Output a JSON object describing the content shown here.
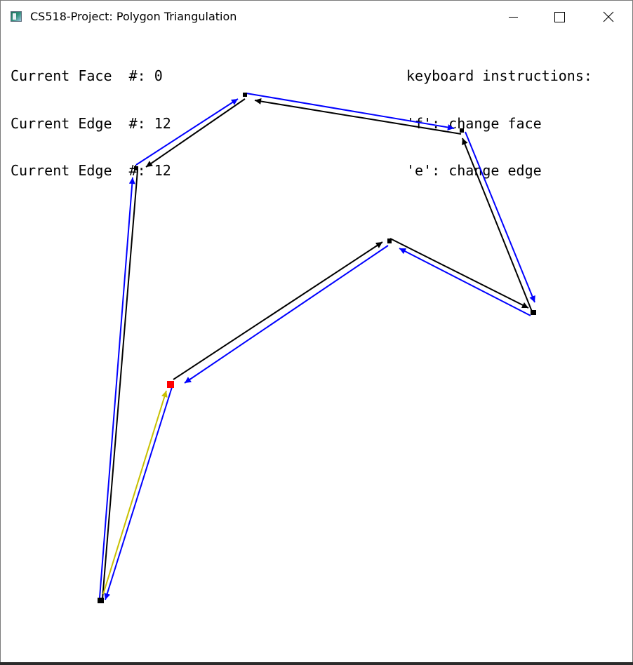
{
  "window": {
    "title": "CS518-Project:  Polygon Triangulation",
    "app_icon": "opengl-window-icon"
  },
  "hud": {
    "left": [
      "Current Face  #: 0",
      "Current Edge  #: 12",
      "Current Edge  #: 12"
    ],
    "right": [
      "keyboard instructions:",
      "'f': change face",
      "'e': change edge"
    ]
  },
  "colors": {
    "edge": "#000000",
    "twin_edge": "#0000ff",
    "current_edge": "#c8c000",
    "current_vertex": "#ff0000"
  },
  "controls": {
    "minimize_icon": "minimize-icon",
    "maximize_icon": "maximize-icon",
    "close_icon": "close-icon"
  }
}
